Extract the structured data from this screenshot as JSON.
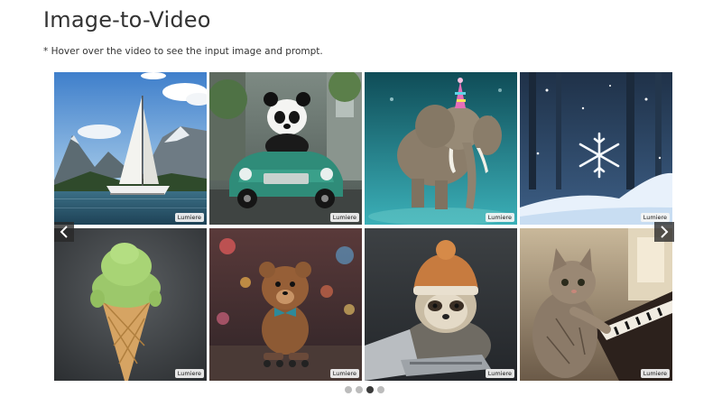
{
  "page": {
    "title": "Image-to-Video",
    "note": "* Hover over the video to see the input image and prompt."
  },
  "gallery": {
    "badge": "Lumiere",
    "tiles": [
      {
        "subject": "sailboat-on-mountain-lake",
        "badge": "Lumiere"
      },
      {
        "subject": "panda-driving-green-car",
        "badge": "Lumiere"
      },
      {
        "subject": "elephant-underwater-with-party-hat",
        "badge": "Lumiere"
      },
      {
        "subject": "snowflake-over-snow",
        "badge": "Lumiere"
      },
      {
        "subject": "green-ice-cream-cone",
        "badge": "Lumiere"
      },
      {
        "subject": "teddy-bear-on-roller-skates",
        "badge": "Lumiere"
      },
      {
        "subject": "sloth-with-knit-hat-at-laptop",
        "badge": "Lumiere"
      },
      {
        "subject": "cat-playing-piano",
        "badge": "Lumiere"
      }
    ]
  },
  "navigation": {
    "prev_icon": "chevron-left-icon",
    "next_icon": "chevron-right-icon"
  },
  "pagination": {
    "count": 4,
    "active_index": 2
  },
  "colors": {
    "nav_bg": "#282828",
    "dot_inactive": "#bcbcbc",
    "dot_active": "#3a3a3a"
  }
}
